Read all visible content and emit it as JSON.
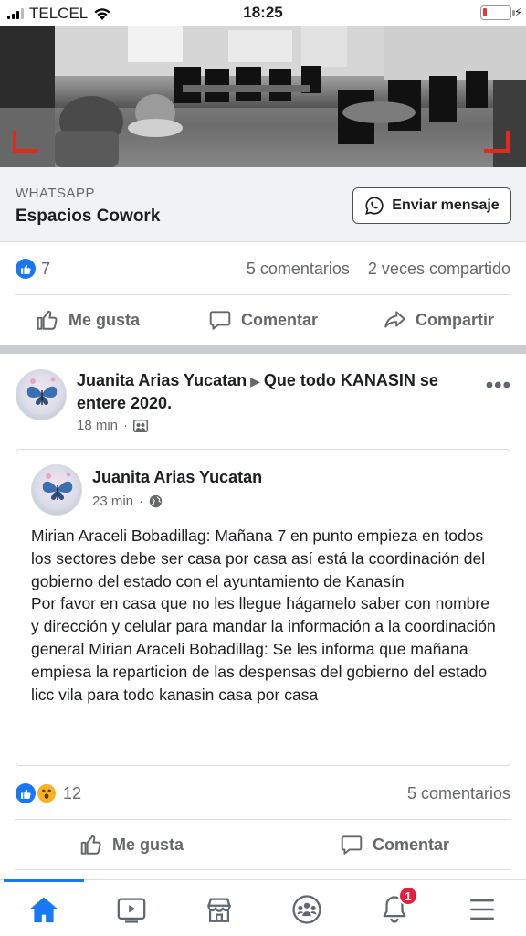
{
  "status_bar": {
    "carrier": "TELCEL",
    "time": "18:25"
  },
  "ad": {
    "source": "WHATSAPP",
    "name": "Espacios Cowork",
    "button_label": "Enviar mensaje"
  },
  "ad_stats": {
    "reactions": "7",
    "comments": "5 comentarios",
    "shares": "2 veces compartido"
  },
  "ad_actions": {
    "like": "Me gusta",
    "comment": "Comentar",
    "share": "Compartir"
  },
  "post": {
    "author": "Juanita Arias Yucatan",
    "target": "Que todo KANASIN se entere 2020.",
    "time": "18 min",
    "shared": {
      "author": "Juanita Arias Yucatan",
      "time": "23 min",
      "body": "Mirian Araceli Bobadillag: Mañana 7 en punto empieza en todos los sectores debe ser casa por casa así está la coordinación del gobierno del estado con el ayuntamiento de Kanasín\n Por favor en casa que no les llegue hágamelo saber con nombre y dirección y celular para mandar la información a la coordinación general Mirian Araceli Bobadillag: Se les informa que mañana empiesa la reparticion de las despensas del gobierno del estado licc vila para todo kanasin casa por casa"
    },
    "stats": {
      "reactions": "12",
      "comments": "5 comentarios"
    },
    "actions": {
      "like": "Me gusta",
      "comment": "Comentar"
    }
  },
  "tab_bar": {
    "tabs": [
      "home-icon",
      "watch-icon",
      "marketplace-icon",
      "groups-icon",
      "notifications-icon",
      "menu-icon"
    ],
    "notification_badge": "1",
    "active_color": "#1877f2"
  }
}
